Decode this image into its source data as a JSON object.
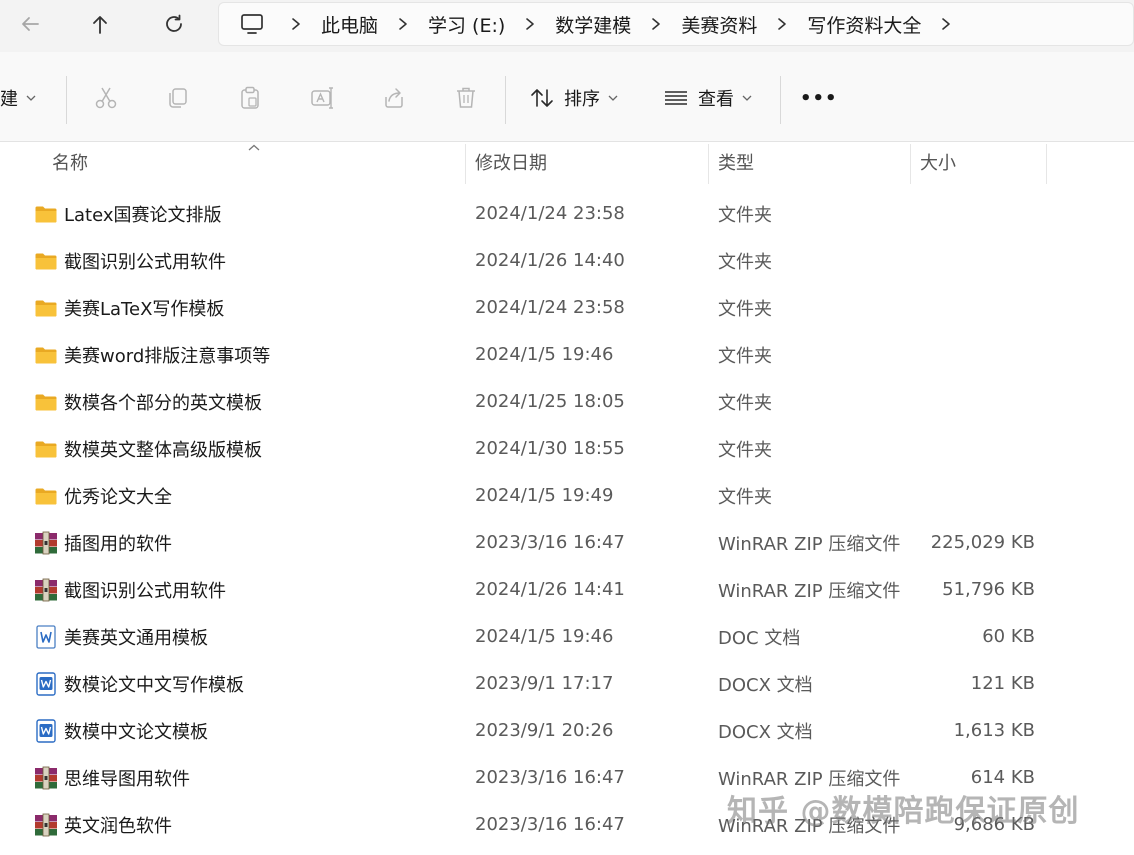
{
  "nav": {
    "back_icon": "arrow-left-icon",
    "up_icon": "arrow-up-icon",
    "refresh_icon": "refresh-icon"
  },
  "breadcrumb": [
    "此电脑",
    "学习 (E:)",
    "数学建模",
    "美赛资料",
    "写作资料大全"
  ],
  "toolbar": {
    "new_label": "新建",
    "sort_label": "排序",
    "view_label": "查看",
    "more_label": "•••"
  },
  "columns": {
    "name": "名称",
    "modified": "修改日期",
    "type": "类型",
    "size": "大小"
  },
  "files": [
    {
      "name": "Latex国赛论文排版",
      "modified": "2024/1/24 23:58",
      "type": "文件夹",
      "size": "",
      "icon": "folder"
    },
    {
      "name": "截图识别公式用软件",
      "modified": "2024/1/26 14:40",
      "type": "文件夹",
      "size": "",
      "icon": "folder"
    },
    {
      "name": "美赛LaTeX写作模板",
      "modified": "2024/1/24 23:58",
      "type": "文件夹",
      "size": "",
      "icon": "folder"
    },
    {
      "name": "美赛word排版注意事项等",
      "modified": "2024/1/5 19:46",
      "type": "文件夹",
      "size": "",
      "icon": "folder"
    },
    {
      "name": "数模各个部分的英文模板",
      "modified": "2024/1/25 18:05",
      "type": "文件夹",
      "size": "",
      "icon": "folder"
    },
    {
      "name": "数模英文整体高级版模板",
      "modified": "2024/1/30 18:55",
      "type": "文件夹",
      "size": "",
      "icon": "folder"
    },
    {
      "name": "优秀论文大全",
      "modified": "2024/1/5 19:49",
      "type": "文件夹",
      "size": "",
      "icon": "folder"
    },
    {
      "name": "插图用的软件",
      "modified": "2023/3/16 16:47",
      "type": "WinRAR ZIP 压缩文件",
      "size": "225,029 KB",
      "icon": "rar"
    },
    {
      "name": "截图识别公式用软件",
      "modified": "2024/1/26 14:41",
      "type": "WinRAR ZIP 压缩文件",
      "size": "51,796 KB",
      "icon": "rar"
    },
    {
      "name": "美赛英文通用模板",
      "modified": "2024/1/5 19:46",
      "type": "DOC 文档",
      "size": "60 KB",
      "icon": "doc-old"
    },
    {
      "name": "数模论文中文写作模板",
      "modified": "2023/9/1 17:17",
      "type": "DOCX 文档",
      "size": "121 KB",
      "icon": "docx"
    },
    {
      "name": "数模中文论文模板",
      "modified": "2023/9/1 20:26",
      "type": "DOCX 文档",
      "size": "1,613 KB",
      "icon": "docx"
    },
    {
      "name": "思维导图用软件",
      "modified": "2023/3/16 16:47",
      "type": "WinRAR ZIP 压缩文件",
      "size": "614 KB",
      "icon": "rar"
    },
    {
      "name": "英文润色软件",
      "modified": "2023/3/16 16:47",
      "type": "WinRAR ZIP 压缩文件",
      "size": "9,686 KB",
      "icon": "rar"
    }
  ],
  "watermark": "知乎 @数模陪跑保证原创",
  "colors": {
    "folder": "#f8c23a",
    "word_blue": "#2b6cc4",
    "rar_red": "#b23a2e"
  }
}
